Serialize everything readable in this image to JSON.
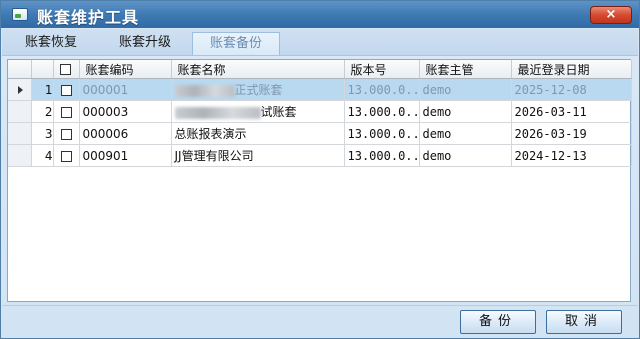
{
  "window": {
    "title": "账套维护工具",
    "close_glyph": "×"
  },
  "tabs": [
    {
      "label": "账套恢复",
      "active": false
    },
    {
      "label": "账套升级",
      "active": false
    },
    {
      "label": "账套备份",
      "active": true
    }
  ],
  "grid": {
    "columns": [
      "账套编码",
      "账套名称",
      "版本号",
      "账套主管",
      "最近登录日期"
    ],
    "rows": [
      {
        "num": "1",
        "code": "000001",
        "name_visible": "正式账套",
        "version": "13.000.0...",
        "manager": "demo",
        "last_login": "2025-12-08",
        "selected": true,
        "current": true
      },
      {
        "num": "2",
        "code": "000003",
        "name_visible": "试账套",
        "version": "13.000.0...",
        "manager": "demo",
        "last_login": "2026-03-11",
        "selected": false,
        "current": false
      },
      {
        "num": "3",
        "code": "000006",
        "name_visible": "总账报表演示",
        "version": "13.000.0...",
        "manager": "demo",
        "last_login": "2026-03-19",
        "selected": false,
        "current": false
      },
      {
        "num": "4",
        "code": "000901",
        "name_visible": "JJ管理有限公司",
        "version": "13.000.0...",
        "manager": "demo",
        "last_login": "2024-12-13",
        "selected": false,
        "current": false
      }
    ]
  },
  "buttons": {
    "backup": "备份",
    "cancel": "取消"
  },
  "colors": {
    "titlebar": "#3d78b3",
    "selected_row": "#b9d9f1",
    "close_button": "#d54a31"
  }
}
